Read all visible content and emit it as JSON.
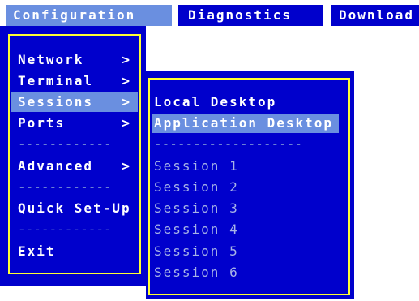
{
  "menubar": {
    "tabs": [
      {
        "label": "Configuration"
      },
      {
        "label": "Diagnostics"
      },
      {
        "label": "Download"
      }
    ]
  },
  "config_menu": {
    "items": [
      {
        "label": "Network",
        "arrow": ">"
      },
      {
        "label": "Terminal",
        "arrow": ">"
      },
      {
        "label": "Sessions",
        "arrow": ">"
      },
      {
        "label": "Ports",
        "arrow": ">"
      },
      {
        "separator": "------------"
      },
      {
        "label": "Advanced",
        "arrow": ">"
      },
      {
        "separator": "------------"
      },
      {
        "label": "Quick Set-Up"
      },
      {
        "separator": "------------"
      },
      {
        "label": "Exit"
      }
    ]
  },
  "sessions_menu": {
    "items": [
      {
        "label": "Local Desktop"
      },
      {
        "label": "Application Desktop"
      },
      {
        "separator": "-------------------"
      },
      {
        "label": "Session 1"
      },
      {
        "label": "Session 2"
      },
      {
        "label": "Session 3"
      },
      {
        "label": "Session 4"
      },
      {
        "label": "Session 5"
      },
      {
        "label": "Session 6"
      }
    ]
  },
  "colors": {
    "panel_bg": "#0000cc",
    "highlight": "#6a8fe0",
    "border": "#ffff33"
  }
}
